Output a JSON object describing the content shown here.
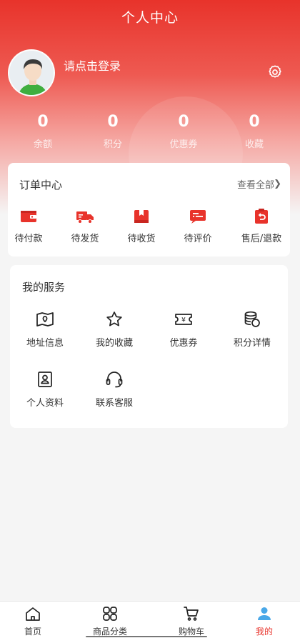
{
  "header": {
    "title": "个人中心"
  },
  "user": {
    "login_prompt": "请点击登录"
  },
  "stats": [
    {
      "value": "0",
      "label": "余额"
    },
    {
      "value": "0",
      "label": "积分"
    },
    {
      "value": "0",
      "label": "优惠券"
    },
    {
      "value": "0",
      "label": "收藏"
    }
  ],
  "orders": {
    "title": "订单中心",
    "view_all": "查看全部",
    "items": [
      {
        "label": "待付款",
        "icon": "wallet-icon"
      },
      {
        "label": "待发货",
        "icon": "truck-icon"
      },
      {
        "label": "待收货",
        "icon": "package-icon"
      },
      {
        "label": "待评价",
        "icon": "comment-icon"
      },
      {
        "label": "售后/退款",
        "icon": "refund-icon"
      }
    ]
  },
  "services": {
    "title": "我的服务",
    "items": [
      {
        "label": "地址信息",
        "icon": "map-icon"
      },
      {
        "label": "我的收藏",
        "icon": "star-icon"
      },
      {
        "label": "优惠券",
        "icon": "coupon-icon"
      },
      {
        "label": "积分详情",
        "icon": "coins-icon"
      },
      {
        "label": "个人资料",
        "icon": "profile-card-icon"
      },
      {
        "label": "联系客服",
        "icon": "headset-icon"
      }
    ]
  },
  "tabbar": [
    {
      "label": "首页",
      "icon": "home-icon",
      "active": false
    },
    {
      "label": "商品分类",
      "icon": "category-icon",
      "active": false
    },
    {
      "label": "购物车",
      "icon": "cart-icon",
      "active": false
    },
    {
      "label": "我的",
      "icon": "user-icon",
      "active": true
    }
  ],
  "colors": {
    "accent": "#e8332b",
    "background": "#f5f5f5"
  }
}
